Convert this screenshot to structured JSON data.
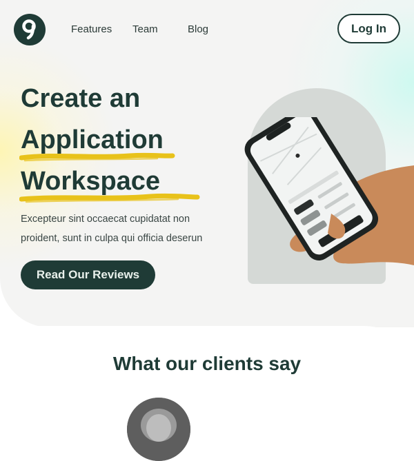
{
  "header": {
    "nav": {
      "features": "Features",
      "team": "Team",
      "blog": "Blog"
    },
    "login_label": "Log In"
  },
  "hero": {
    "headline_line1": "Create an",
    "headline_line2": "Application",
    "headline_line3": "Workspace",
    "description_line1": "Excepteur sint occaecat cupidatat non",
    "description_line2": "proident, sunt in culpa qui officia deserun",
    "cta_label": "Read Our Reviews"
  },
  "testimonials": {
    "title": "What our clients say"
  },
  "colors": {
    "brand_dark": "#1f3b36",
    "highlight": "#e8c21a",
    "arch": "#d5d9d6"
  }
}
